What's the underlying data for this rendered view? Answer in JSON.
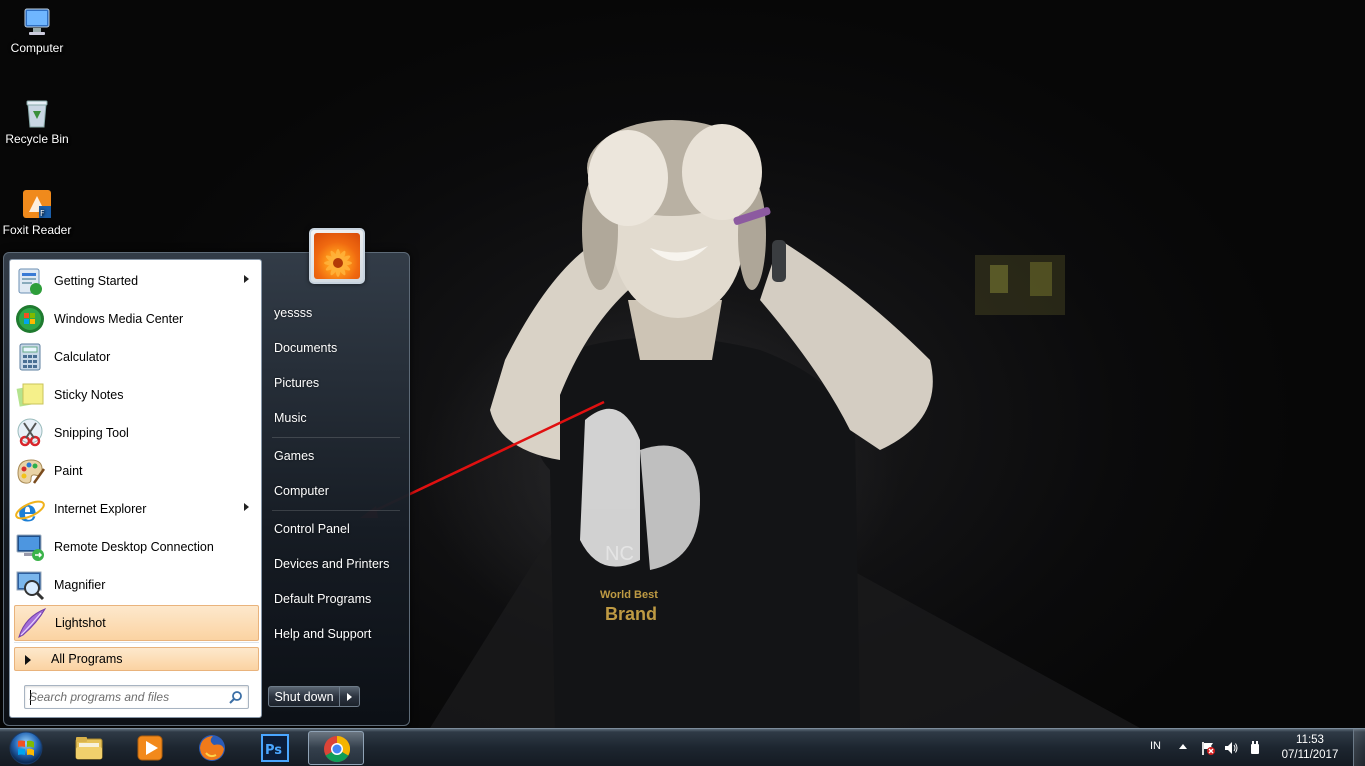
{
  "desktop": {
    "icons": [
      {
        "label": "Computer",
        "icon": "computer-icon"
      },
      {
        "label": "Recycle Bin",
        "icon": "recycle-bin-icon"
      },
      {
        "label": "Foxit Reader",
        "icon": "foxit-reader-icon"
      }
    ]
  },
  "start_menu": {
    "programs": [
      {
        "label": "Getting Started",
        "icon": "getting-started-icon",
        "submenu": true
      },
      {
        "label": "Windows Media Center",
        "icon": "windows-media-center-icon",
        "submenu": false
      },
      {
        "label": "Calculator",
        "icon": "calculator-icon",
        "submenu": false
      },
      {
        "label": "Sticky Notes",
        "icon": "sticky-notes-icon",
        "submenu": false
      },
      {
        "label": "Snipping Tool",
        "icon": "snipping-tool-icon",
        "submenu": false
      },
      {
        "label": "Paint",
        "icon": "paint-icon",
        "submenu": false
      },
      {
        "label": "Internet Explorer",
        "icon": "internet-explorer-icon",
        "submenu": true
      },
      {
        "label": "Remote Desktop Connection",
        "icon": "remote-desktop-icon",
        "submenu": false
      },
      {
        "label": "Magnifier",
        "icon": "magnifier-icon",
        "submenu": false
      },
      {
        "label": "Lightshot",
        "icon": "lightshot-icon",
        "submenu": false,
        "highlighted": true
      }
    ],
    "all_programs_label": "All Programs",
    "search_placeholder": "Search programs and files",
    "right_links": {
      "user": "yessss",
      "documents": "Documents",
      "pictures": "Pictures",
      "music": "Music",
      "games": "Games",
      "computer": "Computer",
      "control_panel": "Control Panel",
      "devices_printers": "Devices and Printers",
      "default_programs": "Default Programs",
      "help_support": "Help and Support"
    },
    "shutdown_label": "Shut down"
  },
  "taskbar": {
    "pinned": [
      {
        "name": "windows-explorer",
        "icon": "folder-icon"
      },
      {
        "name": "windows-media-player",
        "icon": "media-player-icon"
      },
      {
        "name": "firefox",
        "icon": "firefox-icon"
      },
      {
        "name": "photoshop",
        "icon": "photoshop-icon"
      },
      {
        "name": "chrome",
        "icon": "chrome-icon",
        "active": true
      }
    ],
    "tray": {
      "language": "IN",
      "time": "11:53",
      "date": "07/11/2017"
    }
  },
  "colors": {
    "highlight": "#fbd3a2",
    "annotation_arrow": "#e01010",
    "taskbar": "#1d2630"
  }
}
